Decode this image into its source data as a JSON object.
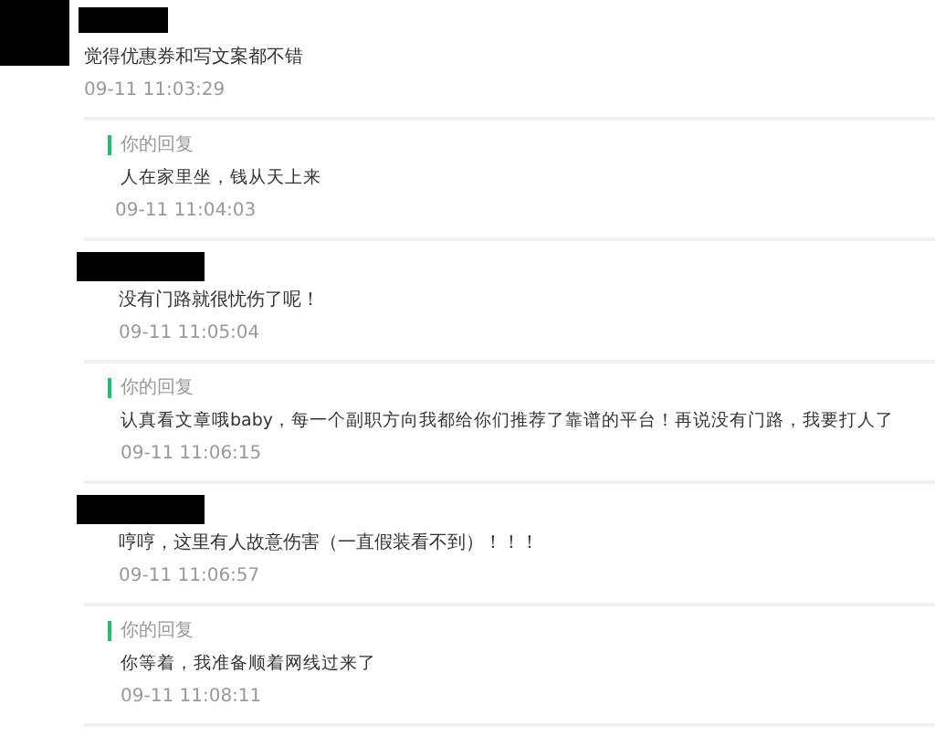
{
  "comments": [
    {
      "avatar": true,
      "text": "觉得优惠券和写文案都不错",
      "time": "09-11 11:03:29",
      "reply": {
        "label": "你的回复",
        "text": "人在家里坐，钱从天上来",
        "time": "09-11 11:04:03"
      }
    },
    {
      "avatar": false,
      "text": "没有门路就很忧伤了呢！",
      "time": "09-11 11:05:04",
      "reply": {
        "label": "你的回复",
        "text": "认真看文章哦baby，每一个副职方向我都给你们推荐了靠谱的平台！再说没有门路，我要打人了",
        "time": "09-11 11:06:15"
      }
    },
    {
      "avatar": false,
      "text": "哼哼，这里有人故意伤害（一直假装看不到）！！！",
      "time": "09-11 11:06:57",
      "reply": {
        "label": "你的回复",
        "text": "你等着，我准备顺着网线过来了",
        "time": "09-11 11:08:11"
      }
    }
  ]
}
